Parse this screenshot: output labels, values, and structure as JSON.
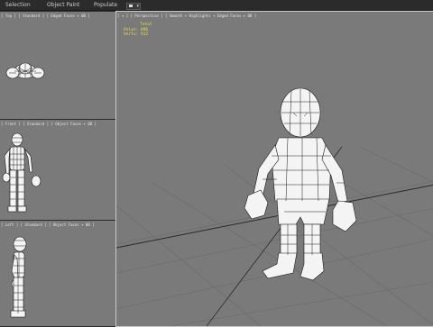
{
  "ribbon": {
    "tabs": [
      "Selection",
      "Object Paint",
      "Populate"
    ]
  },
  "viewports": {
    "top": {
      "label": "[ Top ] [ Standard ] [ Edged Faces + 0B ]"
    },
    "front": {
      "label": "[ Front ] [ Standard ] [ Object Faces + 0B ]"
    },
    "left": {
      "label": "[ Left ] [ Standard ] [ Object Faces + 0B ]"
    },
    "perspective": {
      "label": "[ + ] [ Perspective ] [ Smooth + Highlights + Edged Faces + 0B ]",
      "stats": {
        "title": "Total",
        "polys_label": "Polys:",
        "polys_value": "896",
        "verts_label": "Verts:",
        "verts_value": "912"
      }
    }
  },
  "colors": {
    "viewport_bg": "#7a7a7a",
    "ribbon_bg": "#2b2b2b",
    "stats_text": "#e6e04a",
    "mesh_fill": "#f4f4f4"
  }
}
